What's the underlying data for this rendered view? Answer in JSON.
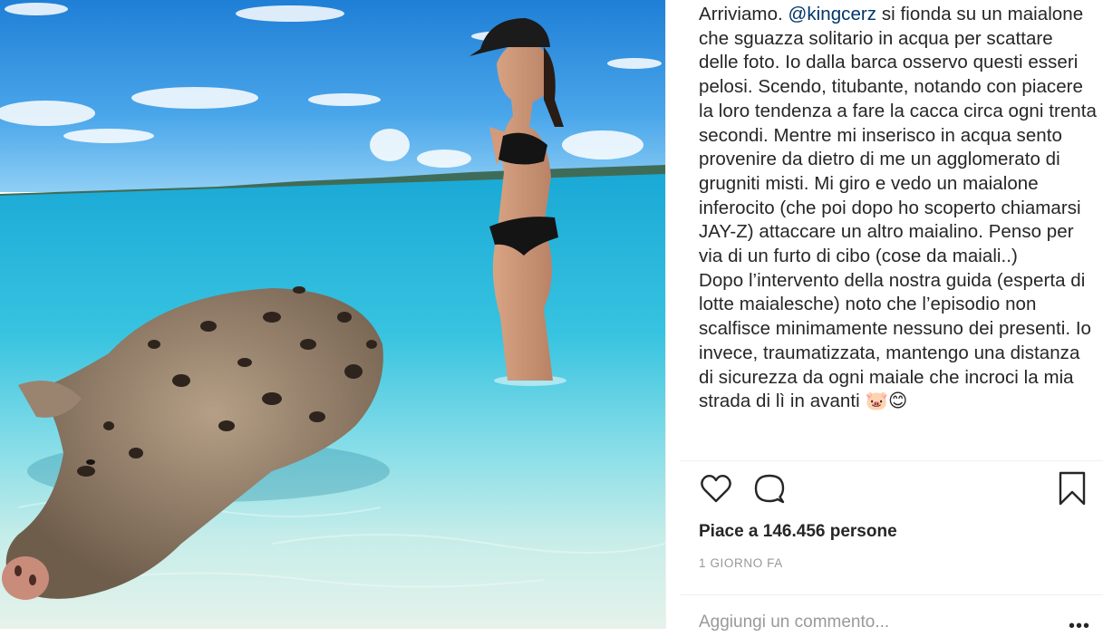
{
  "post": {
    "caption_pre": "Arriviamo. ",
    "mention": "@kingcerz",
    "caption_post": " si fionda su un maialone che sguazza solitario in acqua per scattare delle foto. Io dalla barca osservo questi esseri pelosi. Scendo, titubante, notando con piacere la loro tendenza a fare la cacca circa ogni trenta secondi. Mentre mi inserisco in acqua sento provenire da dietro di me un agglomerato di grugniti misti. Mi giro e vedo un maialone inferocito (che poi dopo ho scoperto chiamarsi JAY-Z) attaccare un altro maialino. Penso per via di un furto di cibo (cose da maiali..)\nDopo l’intervento della nostra guida (esperta di lotte maialesche) noto che l’episodio non scalfisce minimamente nessuno dei presenti. Io invece, traumatizzata, mantengo una distanza di sicurezza da ogni maiale che incroci la mia strada di lì in avanti 🐷😊",
    "likes_text": "Piace a 146.456 persone",
    "time_text": "1 GIORNO FA",
    "comment_placeholder": "Aggiungi un commento...",
    "more_text": "•••"
  },
  "icons": {
    "like": "heart-icon",
    "comment": "speech-bubble-icon",
    "save": "bookmark-icon"
  },
  "colors": {
    "text": "#262626",
    "mention": "#003569",
    "muted": "#999999",
    "divider": "#efefef"
  }
}
